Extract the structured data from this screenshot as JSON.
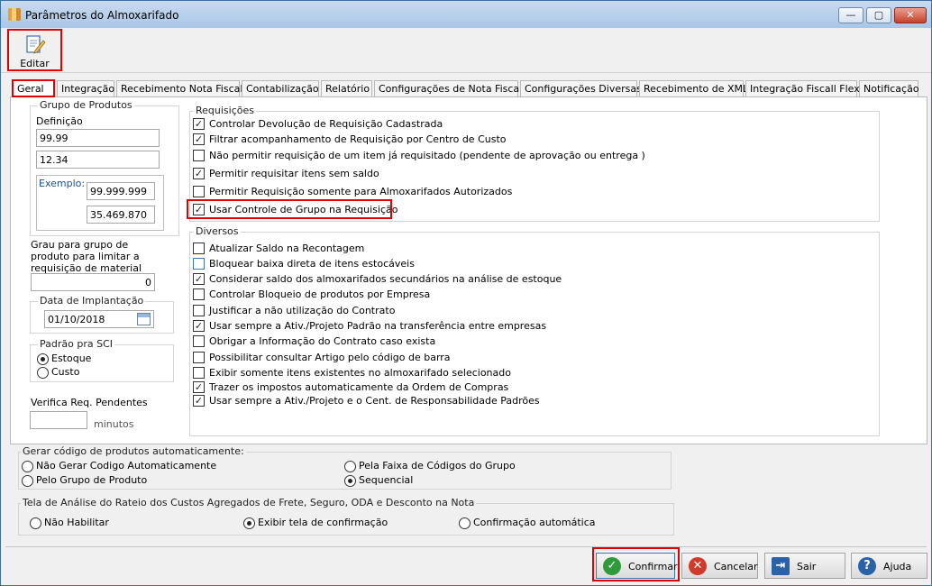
{
  "window": {
    "title": "Parâmetros do Almoxarifado",
    "controls": {
      "minimize": "—",
      "maximize": "▢",
      "close": "✕"
    }
  },
  "toolbar": {
    "edit_label": "Editar",
    "edit_icon": "edit-document-icon"
  },
  "tabs": [
    {
      "label": "Geral",
      "active": true
    },
    {
      "label": "Integração"
    },
    {
      "label": "Recebimento Nota Fiscal"
    },
    {
      "label": "Contabilização"
    },
    {
      "label": "Relatório"
    },
    {
      "label": "Configurações de Nota Fiscal"
    },
    {
      "label": "Configurações Diversas"
    },
    {
      "label": "Recebimento de XML"
    },
    {
      "label": "Integração Fiscall Flex"
    },
    {
      "label": "Notificação"
    }
  ],
  "grupo_produtos": {
    "title": "Grupo de Produtos",
    "definicao_label": "Definição",
    "definicao_value1": "99.99",
    "definicao_value2": "12.34",
    "exemplo_label": "Exemplo:",
    "exemplo_value1": "99.999.999",
    "exemplo_value2": "35.469.870"
  },
  "grau": {
    "label_line1": "Grau para grupo de",
    "label_line2": "produto para limitar a",
    "label_line3": "requisição de material",
    "value": "0"
  },
  "data_implantacao": {
    "title": "Data de Implantação",
    "value": "01/10/2018"
  },
  "padrao_sci": {
    "title": "Padrão pra SCI",
    "options": [
      {
        "label": "Estoque",
        "selected": true
      },
      {
        "label": "Custo",
        "selected": false
      }
    ]
  },
  "verifica": {
    "label": "Verifica Req. Pendentes",
    "value": "",
    "unit": "minutos"
  },
  "requisicoes": {
    "title": "Requisições",
    "items": [
      {
        "label": "Controlar Devolução de Requisição Cadastrada",
        "checked": true
      },
      {
        "label": "Filtrar acompanhamento de Requisição por Centro de Custo",
        "checked": true
      },
      {
        "label": "Não permitir requisição de um item já requisitado (pendente de aprovação ou entrega )",
        "checked": false
      },
      {
        "label": "Permitir requisitar itens sem saldo",
        "checked": true
      },
      {
        "label": "Permitir Requisição somente para Almoxarifados Autorizados",
        "checked": false
      },
      {
        "label": "Usar Controle de Grupo na Requisição",
        "checked": true
      }
    ]
  },
  "diversos": {
    "title": "Diversos",
    "items": [
      {
        "label": "Atualizar Saldo na Recontagem",
        "checked": false
      },
      {
        "label": "Bloquear baixa direta de itens estocáveis",
        "checked": false
      },
      {
        "label": "Considerar saldo dos almoxarifados secundários na análise de estoque",
        "checked": true
      },
      {
        "label": "Controlar Bloqueio de produtos por Empresa",
        "checked": false
      },
      {
        "label": "Justificar a não utilização do Contrato",
        "checked": false
      },
      {
        "label": "Usar sempre a Ativ./Projeto Padrão na transferência entre empresas",
        "checked": true
      },
      {
        "label": "Obrigar a Informação do Contrato caso exista",
        "checked": false
      },
      {
        "label": "Possibilitar consultar Artigo pelo código de barra",
        "checked": false
      },
      {
        "label": "Exibir somente itens existentes no almoxarifado selecionado",
        "checked": false
      },
      {
        "label": "Trazer os impostos automaticamente da Ordem de Compras",
        "checked": true
      },
      {
        "label": "Usar sempre a Ativ./Projeto e o Cent. de Responsabilidade Padrões",
        "checked": true
      }
    ]
  },
  "gerar_codigo": {
    "title": "Gerar código de produtos automaticamente:",
    "options": [
      {
        "label": "Não Gerar Codigo Automaticamente",
        "selected": false
      },
      {
        "label": "Pela Faixa de Códigos do Grupo",
        "selected": false
      },
      {
        "label": "Pelo Grupo de Produto",
        "selected": false
      },
      {
        "label": "Sequencial",
        "selected": true
      }
    ]
  },
  "tela_analise": {
    "title": "Tela de Análise do Rateio dos Custos Agregados de Frete, Seguro, ODA e Desconto na Nota",
    "options": [
      {
        "label": "Não Habilitar",
        "selected": false
      },
      {
        "label": "Exibir tela de confirmação",
        "selected": true
      },
      {
        "label": "Confirmação automática",
        "selected": false
      }
    ]
  },
  "buttons": {
    "confirm": {
      "label": "Confirmar",
      "icon": "check-icon",
      "glyph": "✓",
      "color": "#2e9a3a"
    },
    "cancel": {
      "label": "Cancelar",
      "icon": "cancel-icon",
      "glyph": "✕",
      "color": "#d03a2a"
    },
    "exit": {
      "label": "Sair",
      "icon": "exit-door-icon",
      "glyph": "⇥",
      "color": "#2a62a8"
    },
    "help": {
      "label": "Ajuda",
      "icon": "help-icon",
      "glyph": "?",
      "color": "#2a62a8"
    }
  }
}
